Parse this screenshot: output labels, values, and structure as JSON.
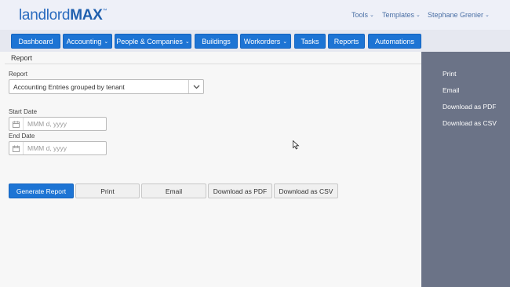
{
  "brand": {
    "name_light": "landlord",
    "name_bold": "MAX",
    "tm": "™"
  },
  "topnav": [
    {
      "label": "Tools"
    },
    {
      "label": "Templates"
    },
    {
      "label": "Stephane Grenier"
    }
  ],
  "navbar": [
    {
      "label": "Dashboard",
      "dropdown": false
    },
    {
      "label": "Accounting",
      "dropdown": true
    },
    {
      "label": "People & Companies",
      "dropdown": true
    },
    {
      "label": "Buildings",
      "dropdown": false
    },
    {
      "label": "Workorders",
      "dropdown": true
    },
    {
      "label": "Tasks",
      "dropdown": false
    },
    {
      "label": "Reports",
      "dropdown": false
    },
    {
      "label": "Automations",
      "dropdown": false
    }
  ],
  "page": {
    "breadcrumb": "Report"
  },
  "form": {
    "report_label": "Report",
    "report_value": "Accounting Entries grouped by tenant",
    "start_label": "Start Date",
    "start_placeholder": "MMM d, yyyy",
    "end_label": "End Date",
    "end_placeholder": "MMM d, yyyy"
  },
  "actions": {
    "generate": "Generate Report",
    "print": "Print",
    "email": "Email",
    "pdf": "Download as PDF",
    "csv": "Download as CSV"
  },
  "sidebar": [
    {
      "label": "Print"
    },
    {
      "label": "Email"
    },
    {
      "label": "Download as PDF"
    },
    {
      "label": "Download as CSV"
    }
  ],
  "colors": {
    "primary": "#1d74d4",
    "sidebar": "#6b7387",
    "brand": "#2a6bbf"
  }
}
